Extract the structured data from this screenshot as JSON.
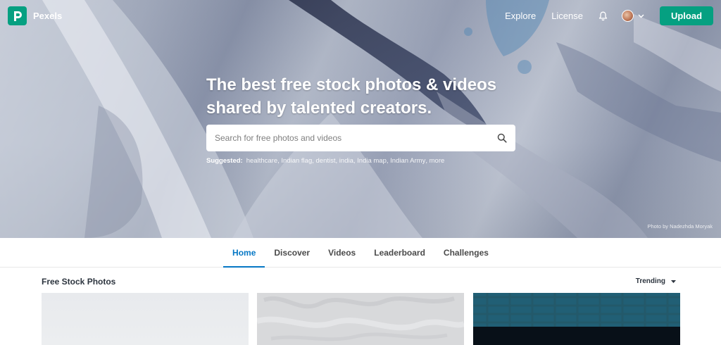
{
  "brand": {
    "name": "Pexels",
    "color": "#05a081"
  },
  "nav": {
    "explore": "Explore",
    "license": "License",
    "upload": "Upload"
  },
  "icons": {
    "logo": "pexels-logo-icon",
    "bell": "bell-icon",
    "avatar": "avatar",
    "chevron": "chevron-down-icon",
    "search": "search-icon",
    "caret": "caret-down-icon"
  },
  "hero": {
    "headline_line1": "The best free stock photos & videos",
    "headline_line2": "shared by talented creators.",
    "search_placeholder": "Search for free photos and videos",
    "suggested_label": "Suggested:",
    "suggested": [
      "healthcare",
      "Indian flag",
      "dentist",
      "india",
      "India map",
      "Indian Army",
      "more"
    ],
    "credit": "Photo by Nadezhda Moryak"
  },
  "tabs": [
    {
      "label": "Home",
      "active": true
    },
    {
      "label": "Discover",
      "active": false
    },
    {
      "label": "Videos",
      "active": false
    },
    {
      "label": "Leaderboard",
      "active": false
    },
    {
      "label": "Challenges",
      "active": false
    }
  ],
  "content": {
    "section_title": "Free Stock Photos",
    "sort_label": "Trending"
  },
  "colors": {
    "accent": "#05a081",
    "tab_active": "#0577c5"
  }
}
